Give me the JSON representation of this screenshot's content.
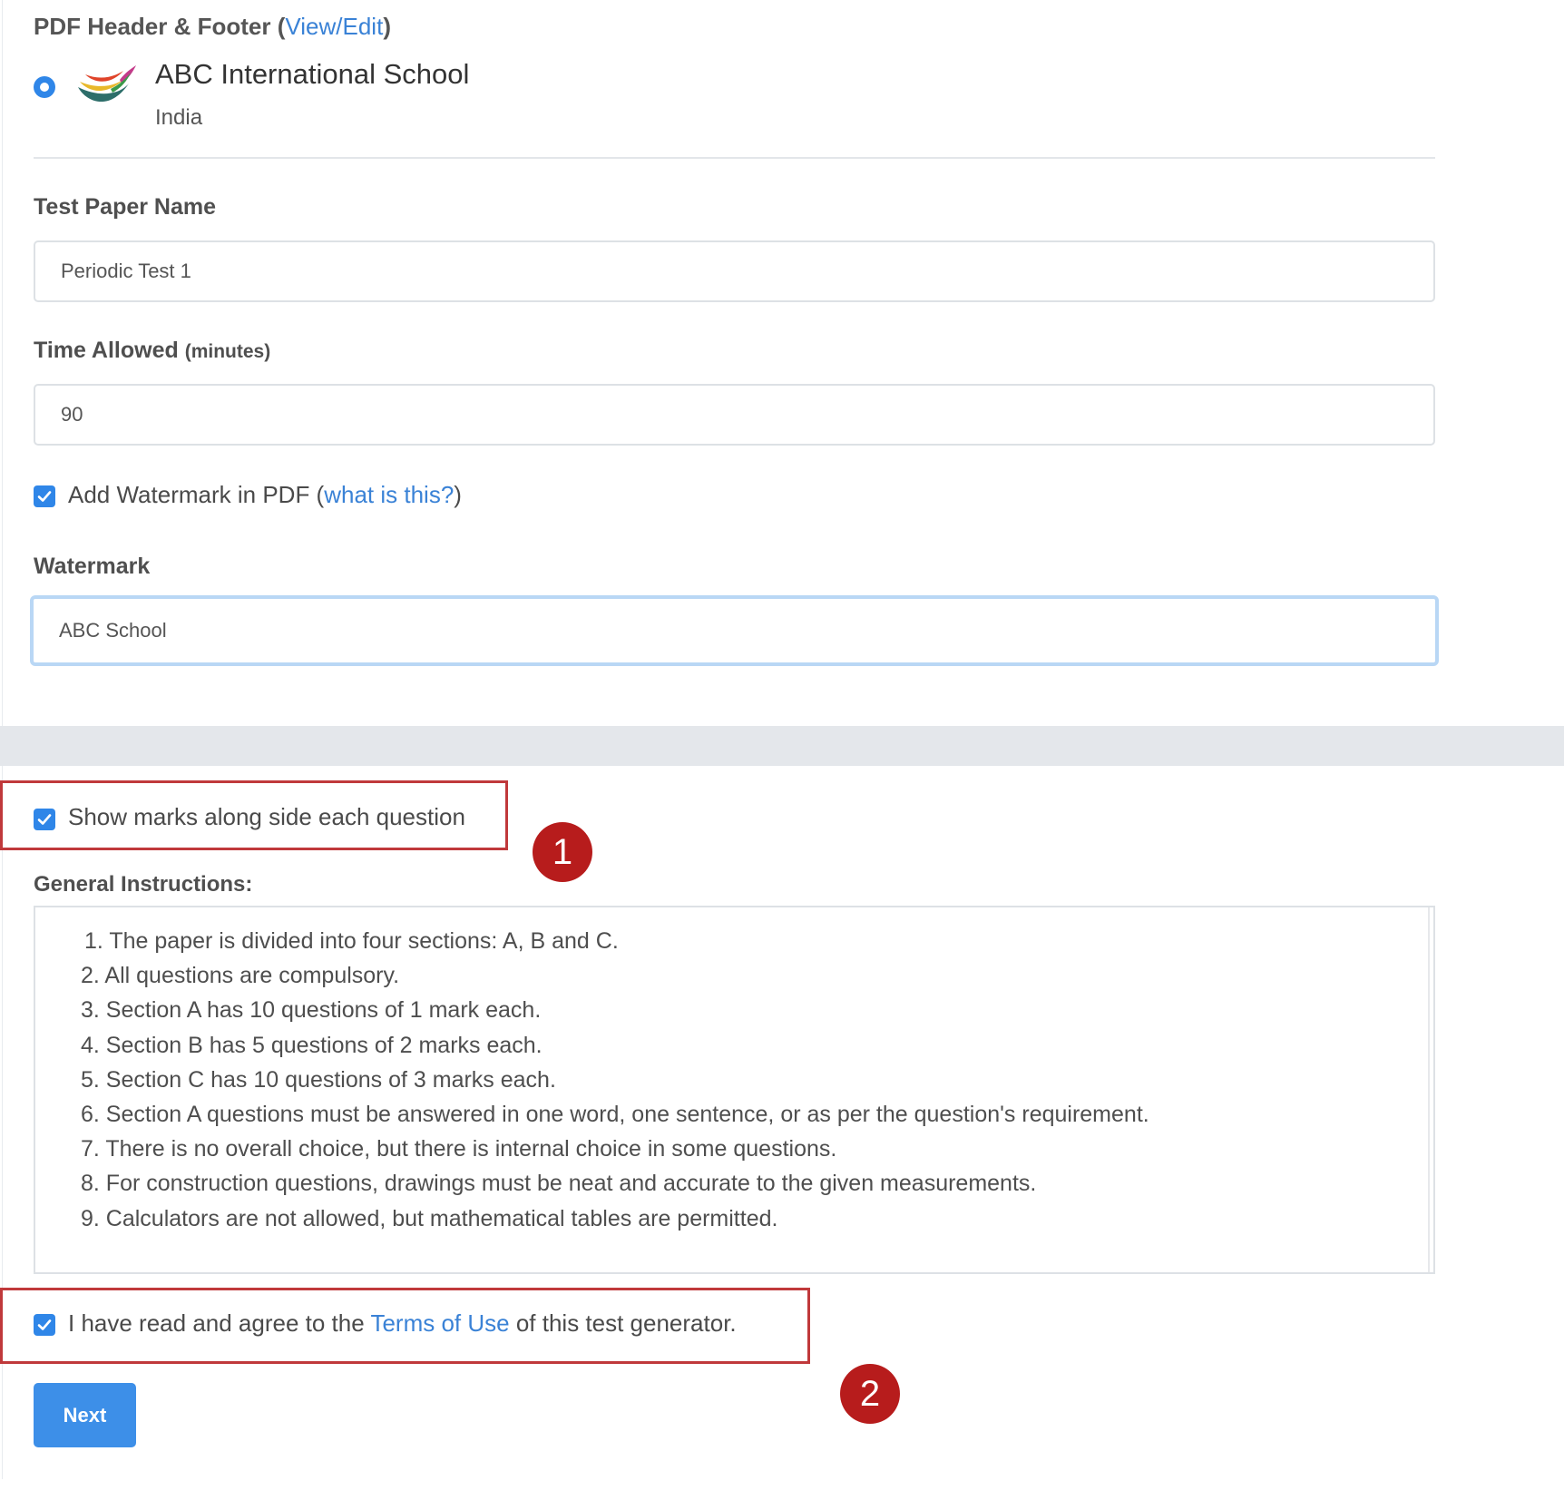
{
  "header": {
    "label": "PDF Header & Footer",
    "open_paren": " (",
    "link_text": "View/Edit",
    "close_paren": ")"
  },
  "school": {
    "name": "ABC International School",
    "country": "India"
  },
  "test_paper_name": {
    "label": "Test Paper Name",
    "value": "Periodic Test 1"
  },
  "time_allowed": {
    "label": "Time Allowed",
    "unit": "(minutes)",
    "value": "90"
  },
  "watermark_toggle": {
    "label": "Add Watermark in PDF",
    "open_paren": " (",
    "link_text": "what is this?",
    "close_paren": ")",
    "checked": true
  },
  "watermark": {
    "label": "Watermark",
    "value": "ABC School"
  },
  "show_marks": {
    "label": "Show marks along side each question",
    "checked": true,
    "annotation": "1"
  },
  "general_instructions": {
    "label": "General Instructions:",
    "items": [
      "1. The paper is divided into four sections: A, B and C.",
      "2. All questions are compulsory.",
      "3. Section A has 10 questions of 1 mark each.",
      "4. Section B has 5 questions of 2 marks each.",
      "5. Section C has 10 questions of 3 marks each.",
      "6. Section A questions must be answered in one word, one sentence, or as per the question's requirement.",
      "7. There is no overall choice, but there is internal choice in some questions.",
      "8. For construction questions, drawings must be neat and accurate to the given measurements.",
      "9. Calculators are not allowed, but mathematical tables are permitted."
    ]
  },
  "terms": {
    "prefix": "I have read and agree to the ",
    "link_text": "Terms of Use",
    "suffix": " of this test generator.",
    "checked": true,
    "annotation": "2"
  },
  "next_button": {
    "label": "Next"
  },
  "colors": {
    "accent": "#2f86e8",
    "link": "#3a82d6",
    "annotation_red": "#b71c1c"
  }
}
